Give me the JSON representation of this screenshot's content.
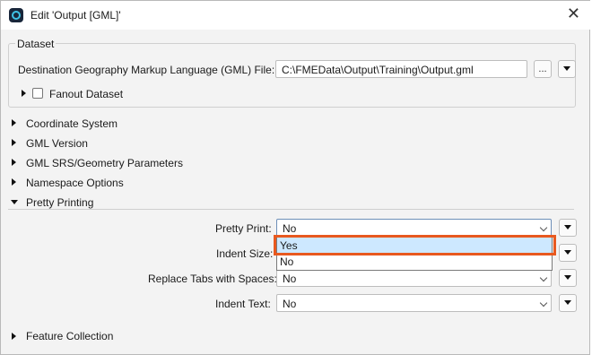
{
  "window": {
    "title": "Edit 'Output [GML]'",
    "close": "✕"
  },
  "dataset": {
    "group_title": "Dataset",
    "dest_label": "Destination Geography Markup Language (GML) File:",
    "dest_value": "C:\\FMEData\\Output\\Training\\Output.gml",
    "browse_label": "...",
    "fanout_label": "Fanout Dataset"
  },
  "sections": [
    {
      "label": "Coordinate System"
    },
    {
      "label": "GML Version"
    },
    {
      "label": "GML SRS/Geometry Parameters"
    },
    {
      "label": "Namespace Options"
    },
    {
      "label": "Pretty Printing"
    },
    {
      "label": "Feature Collection"
    }
  ],
  "pretty_printing": {
    "pretty_print_label": "Pretty Print:",
    "pretty_print_value": "No",
    "indent_size_label": "Indent Size:",
    "replace_tabs_label": "Replace Tabs with Spaces:",
    "replace_tabs_value": "No",
    "indent_text_label": "Indent Text:",
    "indent_text_value": "No"
  },
  "dropdown": {
    "options": [
      "Yes",
      "No"
    ],
    "selected": "Yes"
  }
}
